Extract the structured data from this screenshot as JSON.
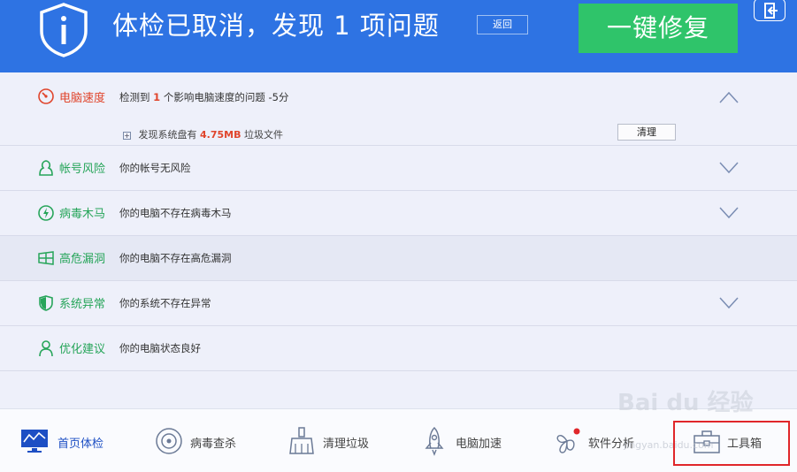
{
  "header": {
    "title": "体检已取消，发现 1 项问题",
    "back_label": "返回",
    "fix_label": "一键修复"
  },
  "rows": [
    {
      "category": "电脑速度",
      "desc_prefix": "检测到",
      "desc_number": "1",
      "desc_suffix": "个影响电脑速度的问题",
      "score": "-5分",
      "sub": {
        "prefix": "发现系统盘有",
        "size": "4.75MB",
        "suffix": "垃圾文件",
        "button": "清理"
      },
      "icon": "speed-gauge-icon",
      "expanded": true
    },
    {
      "category": "帐号风险",
      "desc": "你的帐号无风险",
      "icon": "account-icon"
    },
    {
      "category": "病毒木马",
      "desc": "你的电脑不存在病毒木马",
      "icon": "virus-icon"
    },
    {
      "category": "高危漏洞",
      "desc": "你的电脑不存在高危漏洞",
      "icon": "windows-icon"
    },
    {
      "category": "系统异常",
      "desc": "你的系统不存在异常",
      "icon": "system-shield-icon"
    },
    {
      "category": "优化建议",
      "desc": "你的电脑状态良好",
      "icon": "person-icon"
    }
  ],
  "nav": [
    {
      "label": "首页体检",
      "icon": "monitor-checkup-icon",
      "active": true
    },
    {
      "label": "病毒查杀",
      "icon": "virus-scan-icon"
    },
    {
      "label": "清理垃圾",
      "icon": "broom-icon"
    },
    {
      "label": "电脑加速",
      "icon": "rocket-icon"
    },
    {
      "label": "软件分析",
      "icon": "software-analysis-icon"
    },
    {
      "label": "工具箱",
      "icon": "toolbox-icon"
    }
  ],
  "watermark": {
    "main": "Bai du 经验",
    "sub": "jingyan.baidu.com"
  },
  "colors": {
    "header_bg": "#2e73e3",
    "fix_button": "#2fc46a",
    "category_green": "#27a55a",
    "alert_red": "#e0452c",
    "nav_active": "#1d4fc4",
    "highlight_box": "#e0262a"
  }
}
